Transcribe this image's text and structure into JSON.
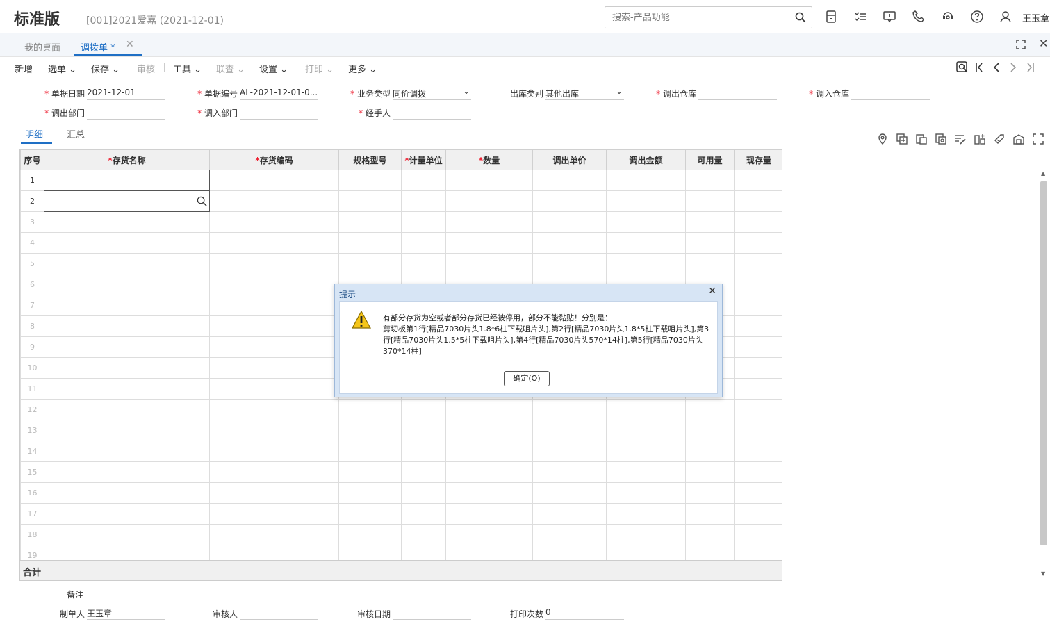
{
  "header": {
    "brand": "标准版",
    "account": "[001]2021爱嘉  (2021-12-01)",
    "search_placeholder": "搜索-产品功能",
    "user": "王玉章"
  },
  "tabs": [
    {
      "label": "我的桌面"
    },
    {
      "label": "调拨单 *"
    }
  ],
  "toolbar": {
    "new": "新增",
    "select": "选单",
    "save": "保存",
    "review": "审核",
    "tools": "工具",
    "query": "联查",
    "settings": "设置",
    "print": "打印",
    "more": "更多"
  },
  "form": {
    "date_label": "单据日期",
    "date_value": "2021-12-01",
    "no_label": "单据编号",
    "no_value": "AL-2021-12-01-0...",
    "biz_label": "业务类型",
    "biz_value": "同价调拨",
    "outtype_label": "出库类别",
    "outtype_value": "其他出库",
    "outwh_label": "调出仓库",
    "inwh_label": "调入仓库",
    "outdept_label": "调出部门",
    "indept_label": "调入部门",
    "handler_label": "经手人"
  },
  "subtabs": {
    "detail": "明细",
    "summary": "汇总"
  },
  "grid": {
    "columns": [
      "序号",
      "存货名称",
      "存货编码",
      "规格型号",
      "计量单位",
      "数量",
      "调出单价",
      "调出金额",
      "可用量",
      "现存量"
    ],
    "rows": [
      "1",
      "2",
      "3",
      "4",
      "5",
      "6",
      "7",
      "8",
      "9",
      "10",
      "11",
      "12",
      "13",
      "14",
      "15",
      "16",
      "17",
      "18",
      "19"
    ],
    "total_label": "合计"
  },
  "footer": {
    "remark_label": "备注",
    "maker_label": "制单人",
    "maker_value": "王玉章",
    "reviewer_label": "审核人",
    "review_date_label": "审核日期",
    "print_count_label": "打印次数",
    "print_count_value": "0"
  },
  "dialog": {
    "title": "提示",
    "line1": "有部分存货为空或者部分存货已经被停用，部分不能黏贴！分别是：",
    "line2": "剪切板第1行[精品7030片头1.8*6柱下载咀片头],第2行[精品7030片头1.8*5柱下载咀片头],第3行[精品7030片头1.5*5柱下载咀片头],第4行[精品7030片头570*14柱],第5行[精品7030片头370*14柱]",
    "ok_label": "确定(O)"
  },
  "colors": {
    "accent": "#1f6fc5",
    "required": "#e22233",
    "dialog_frame": "#d7e5f5"
  }
}
